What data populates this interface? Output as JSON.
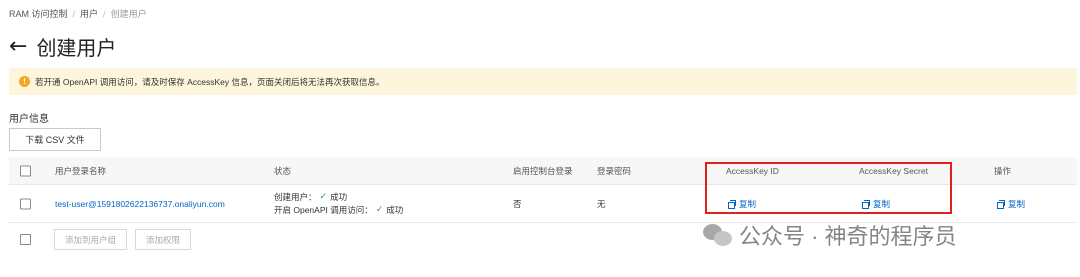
{
  "breadcrumb": {
    "items": [
      "RAM 访问控制",
      "用户",
      "创建用户"
    ],
    "separator": "/"
  },
  "header": {
    "back_icon": "←",
    "title": "创建用户"
  },
  "alert": {
    "icon": "!",
    "text": "若开通 OpenAPI 调用访问，请及时保存 AccessKey 信息，页面关闭后将无法再次获取信息。"
  },
  "section": {
    "title": "用户信息"
  },
  "csv_button": {
    "label": "下载 CSV 文件"
  },
  "table": {
    "columns": [
      "用户登录名称",
      "状态",
      "启用控制台登录",
      "登录密码",
      "AccessKey ID",
      "AccessKey Secret",
      "操作"
    ],
    "rows": [
      {
        "login_name": "test-user@1591802622136737.onaliyun.com",
        "status_line1_label": "创建用户：",
        "status_line1_value": "成功",
        "status_line2_label": "开启 OpenAPI 调用访问：",
        "status_line2_value": "成功",
        "console_login": "否",
        "password": "无",
        "access_key_id_action": "复制",
        "access_key_secret_action": "复制",
        "operation_action": "复制"
      }
    ]
  },
  "footer": {
    "add_to_group": "添加到用户组",
    "add_permission": "添加权限"
  },
  "watermark": {
    "text": "公众号 · 神奇的程序员"
  },
  "colors": {
    "link": "#0064c8",
    "alert_bg": "#fdf6dc",
    "alert_icon": "#f5a623",
    "success": "#2e9e3c",
    "highlight_border": "#e0201b"
  }
}
